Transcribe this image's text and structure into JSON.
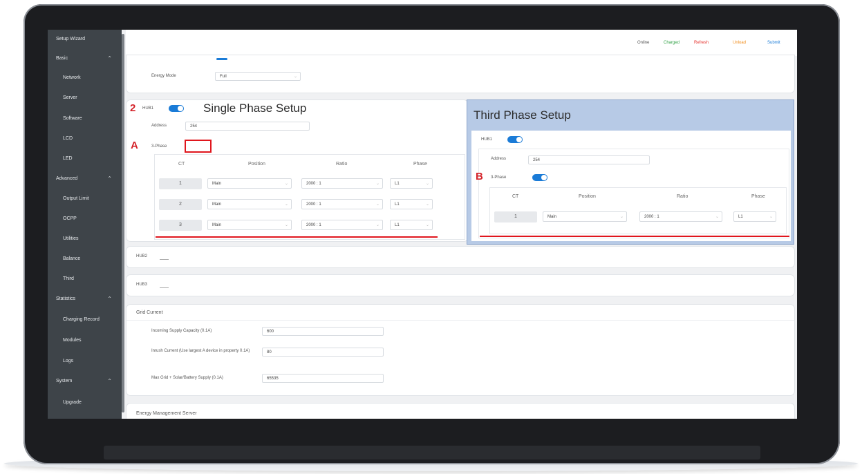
{
  "sidebar": {
    "items": [
      {
        "label": "Setup Wizard",
        "level": "top"
      },
      {
        "label": "Basic",
        "level": "top",
        "chevron": "⌃"
      },
      {
        "label": "Network",
        "level": "sub"
      },
      {
        "label": "Server",
        "level": "sub"
      },
      {
        "label": "Software",
        "level": "sub"
      },
      {
        "label": "LCD",
        "level": "sub"
      },
      {
        "label": "LED",
        "level": "sub"
      },
      {
        "label": "Advanced",
        "level": "top",
        "chevron": "⌃"
      },
      {
        "label": "Output Limit",
        "level": "sub"
      },
      {
        "label": "OCPP",
        "level": "sub"
      },
      {
        "label": "Utilities",
        "level": "sub"
      },
      {
        "label": "Balance",
        "level": "sub"
      },
      {
        "label": "Third",
        "level": "sub"
      },
      {
        "label": "Statistics",
        "level": "top",
        "chevron": "⌃"
      },
      {
        "label": "Charging Record",
        "level": "sub"
      },
      {
        "label": "Modules",
        "level": "sub"
      },
      {
        "label": "Logs",
        "level": "sub"
      },
      {
        "label": "System",
        "level": "top",
        "chevron": "⌃"
      },
      {
        "label": "Upgrade",
        "level": "sub"
      }
    ]
  },
  "status_bar": [
    {
      "label": "Online",
      "color": "#555555"
    },
    {
      "label": "Charged",
      "color": "#2ea043"
    },
    {
      "label": "Refresh",
      "color": "#e5322d"
    },
    {
      "label": "Unload",
      "color": "#f08c1a"
    },
    {
      "label": "Submit",
      "color": "#1a7bd7"
    }
  ],
  "energy": {
    "mode_label": "Energy Mode",
    "mode_value": "Full"
  },
  "single_phase": {
    "marker": "2",
    "hub_label": "HUB1",
    "heading": "Single Phase Setup",
    "address_label": "Address",
    "address_value": "254",
    "three_phase_marker": "A",
    "three_phase_label": "3-Phase",
    "columns": [
      "CT",
      "Position",
      "Ratio",
      "Phase"
    ],
    "rows": [
      {
        "ct": "1",
        "position": "Main",
        "ratio": "2000 : 1",
        "phase": "L1"
      },
      {
        "ct": "2",
        "position": "Main",
        "ratio": "2000 : 1",
        "phase": "L1"
      },
      {
        "ct": "3",
        "position": "Main",
        "ratio": "2000 : 1",
        "phase": "L1"
      }
    ]
  },
  "third_phase": {
    "heading": "Third Phase Setup",
    "hub_label": "HUB1",
    "address_label": "Address",
    "address_value": "254",
    "marker": "B",
    "three_phase_label": "3-Phase",
    "columns": [
      "CT",
      "Position",
      "Ratio",
      "Phase"
    ],
    "rows": [
      {
        "ct": "1",
        "position": "Main",
        "ratio": "2000 : 1",
        "phase": "L1"
      }
    ]
  },
  "hub2": {
    "label": "HUB2"
  },
  "hub3": {
    "label": "HUB3"
  },
  "grid_current": {
    "title": "Grid Current",
    "fields": [
      {
        "label": "Incoming Supply Capacity (0.1A)",
        "value": "600"
      },
      {
        "label": "Inrush Current (Use largest A device in property 0.1A)",
        "value": "80"
      },
      {
        "label": "Max Grid + Solar/Battery Supply (0.1A)",
        "value": "65535"
      }
    ]
  },
  "energy_server": {
    "title": "Energy Management Server"
  }
}
